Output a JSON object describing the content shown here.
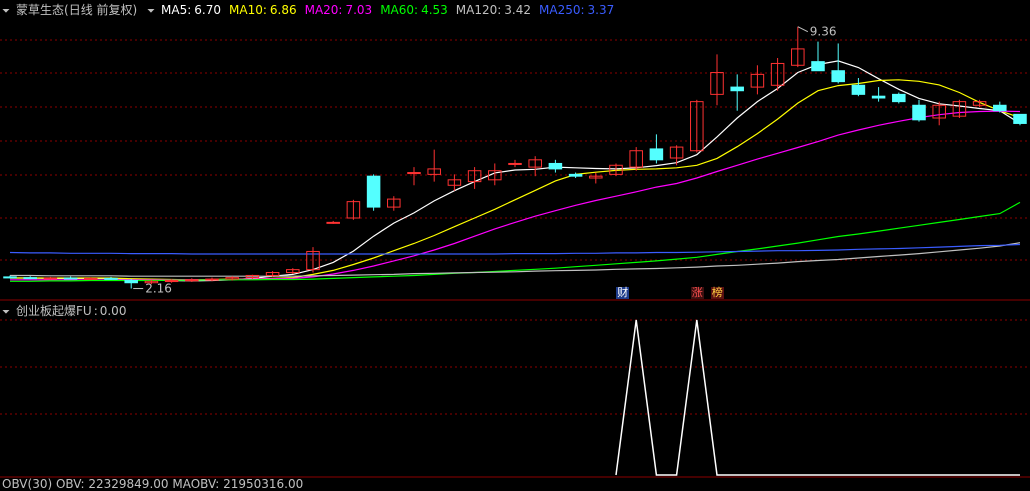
{
  "header": {
    "stock_name": "蒙草生态",
    "period": "(日线 前复权)",
    "ma": [
      {
        "label": "MA5:",
        "value": "6.70",
        "color": "#ffffff"
      },
      {
        "label": "MA10:",
        "value": "6.86",
        "color": "#ffff00"
      },
      {
        "label": "MA20:",
        "value": "7.03",
        "color": "#ff00ff"
      },
      {
        "label": "MA60:",
        "value": "4.53",
        "color": "#00ff00"
      },
      {
        "label": "MA120:",
        "value": "3.42",
        "color": "#c0c0c0"
      },
      {
        "label": "MA250:",
        "value": "3.37",
        "color": "#3a5cff"
      }
    ]
  },
  "indicator": {
    "name": "创业板起爆FU",
    "sep": ":",
    "value": "0.00"
  },
  "bottom": {
    "text": "OBV(30)  OBV: 22329849.00  MAOBV: 21950316.00"
  },
  "badges": [
    {
      "text": "财",
      "color": "#ffffff",
      "bg": "#1e3c8c"
    },
    {
      "text": "涨",
      "color": "#ff5050",
      "bg": "#3c1010"
    },
    {
      "text": "榜",
      "color": "#ffd040",
      "bg": "#5a1010"
    }
  ],
  "annotations": {
    "high": "9.36",
    "low": "2.16"
  },
  "colors": {
    "up": "#ff3232",
    "down": "#54ffff",
    "grid": "#8b0000",
    "signal": "#ffffff"
  },
  "chart_data": [
    {
      "type": "candlestick",
      "title": "蒙草生态 (日线 前复权)",
      "ylim": [
        1.9,
        9.6
      ],
      "candles": [
        {
          "o": 2.48,
          "h": 2.52,
          "l": 2.44,
          "c": 2.46
        },
        {
          "o": 2.46,
          "h": 2.5,
          "l": 2.42,
          "c": 2.44
        },
        {
          "o": 2.44,
          "h": 2.48,
          "l": 2.4,
          "c": 2.45
        },
        {
          "o": 2.45,
          "h": 2.49,
          "l": 2.41,
          "c": 2.43
        },
        {
          "o": 2.43,
          "h": 2.47,
          "l": 2.39,
          "c": 2.44
        },
        {
          "o": 2.44,
          "h": 2.48,
          "l": 2.4,
          "c": 2.42
        },
        {
          "o": 2.38,
          "h": 2.42,
          "l": 2.16,
          "c": 2.32
        },
        {
          "o": 2.32,
          "h": 2.4,
          "l": 2.28,
          "c": 2.36
        },
        {
          "o": 2.36,
          "h": 2.42,
          "l": 2.32,
          "c": 2.38
        },
        {
          "o": 2.38,
          "h": 2.44,
          "l": 2.34,
          "c": 2.4
        },
        {
          "o": 2.4,
          "h": 2.46,
          "l": 2.36,
          "c": 2.42
        },
        {
          "o": 2.42,
          "h": 2.5,
          "l": 2.38,
          "c": 2.46
        },
        {
          "o": 2.46,
          "h": 2.54,
          "l": 2.42,
          "c": 2.52
        },
        {
          "o": 2.52,
          "h": 2.64,
          "l": 2.48,
          "c": 2.6
        },
        {
          "o": 2.6,
          "h": 2.72,
          "l": 2.56,
          "c": 2.68
        },
        {
          "o": 2.68,
          "h": 3.3,
          "l": 2.6,
          "c": 3.18
        },
        {
          "o": 3.98,
          "h": 4.02,
          "l": 3.94,
          "c": 3.98
        },
        {
          "o": 4.1,
          "h": 4.6,
          "l": 4.05,
          "c": 4.55
        },
        {
          "o": 5.25,
          "h": 5.3,
          "l": 4.3,
          "c": 4.4
        },
        {
          "o": 4.4,
          "h": 4.7,
          "l": 4.3,
          "c": 4.62
        },
        {
          "o": 5.35,
          "h": 5.5,
          "l": 5.0,
          "c": 5.35
        },
        {
          "o": 5.3,
          "h": 5.98,
          "l": 5.1,
          "c": 5.45
        },
        {
          "o": 5.0,
          "h": 5.3,
          "l": 4.85,
          "c": 5.15
        },
        {
          "o": 5.1,
          "h": 5.5,
          "l": 4.9,
          "c": 5.4
        },
        {
          "o": 5.15,
          "h": 5.6,
          "l": 5.0,
          "c": 5.4
        },
        {
          "o": 5.6,
          "h": 5.7,
          "l": 5.5,
          "c": 5.6
        },
        {
          "o": 5.5,
          "h": 5.8,
          "l": 5.25,
          "c": 5.7
        },
        {
          "o": 5.6,
          "h": 5.7,
          "l": 5.35,
          "c": 5.45
        },
        {
          "o": 5.3,
          "h": 5.35,
          "l": 5.2,
          "c": 5.25
        },
        {
          "o": 5.2,
          "h": 5.35,
          "l": 5.05,
          "c": 5.25
        },
        {
          "o": 5.3,
          "h": 5.6,
          "l": 5.25,
          "c": 5.55
        },
        {
          "o": 5.5,
          "h": 6.05,
          "l": 5.4,
          "c": 5.95
        },
        {
          "o": 6.0,
          "h": 6.4,
          "l": 5.6,
          "c": 5.7
        },
        {
          "o": 5.75,
          "h": 6.1,
          "l": 5.55,
          "c": 6.05
        },
        {
          "o": 5.95,
          "h": 7.35,
          "l": 5.9,
          "c": 7.3
        },
        {
          "o": 7.5,
          "h": 8.6,
          "l": 7.2,
          "c": 8.1
        },
        {
          "o": 7.7,
          "h": 8.05,
          "l": 7.05,
          "c": 7.6
        },
        {
          "o": 7.7,
          "h": 8.3,
          "l": 7.5,
          "c": 8.05
        },
        {
          "o": 7.75,
          "h": 8.5,
          "l": 7.6,
          "c": 8.35
        },
        {
          "o": 8.3,
          "h": 9.36,
          "l": 8.25,
          "c": 8.75
        },
        {
          "o": 8.4,
          "h": 8.95,
          "l": 8.2,
          "c": 8.15
        },
        {
          "o": 8.15,
          "h": 8.9,
          "l": 7.8,
          "c": 7.85
        },
        {
          "o": 7.75,
          "h": 7.95,
          "l": 7.45,
          "c": 7.5
        },
        {
          "o": 7.45,
          "h": 7.7,
          "l": 7.3,
          "c": 7.4
        },
        {
          "o": 7.5,
          "h": 7.55,
          "l": 7.25,
          "c": 7.3
        },
        {
          "o": 7.2,
          "h": 7.35,
          "l": 6.75,
          "c": 6.8
        },
        {
          "o": 6.85,
          "h": 7.3,
          "l": 6.65,
          "c": 7.2
        },
        {
          "o": 6.9,
          "h": 7.35,
          "l": 6.85,
          "c": 7.3
        },
        {
          "o": 7.2,
          "h": 7.35,
          "l": 7.15,
          "c": 7.3
        },
        {
          "o": 7.2,
          "h": 7.3,
          "l": 7.0,
          "c": 7.05
        },
        {
          "o": 6.95,
          "h": 6.95,
          "l": 6.65,
          "c": 6.7
        }
      ],
      "ma_lines": [
        {
          "name": "MA5",
          "color": "#ffffff",
          "values": [
            2.45,
            2.45,
            2.44,
            2.44,
            2.44,
            2.44,
            2.41,
            2.39,
            2.38,
            2.37,
            2.38,
            2.4,
            2.44,
            2.5,
            2.55,
            2.68,
            2.88,
            3.19,
            3.6,
            3.96,
            4.24,
            4.57,
            4.85,
            5.1,
            5.34,
            5.42,
            5.44,
            5.5,
            5.48,
            5.46,
            5.45,
            5.48,
            5.54,
            5.62,
            5.84,
            6.33,
            6.85,
            7.3,
            7.66,
            8.1,
            8.32,
            8.42,
            8.24,
            7.93,
            7.64,
            7.39,
            7.24,
            7.18,
            7.11,
            7.05,
            6.7
          ]
        },
        {
          "name": "MA10",
          "color": "#ffff00",
          "values": [
            2.45,
            2.45,
            2.45,
            2.45,
            2.45,
            2.45,
            2.43,
            2.42,
            2.41,
            2.4,
            2.41,
            2.42,
            2.42,
            2.44,
            2.46,
            2.55,
            2.66,
            2.82,
            3.0,
            3.2,
            3.4,
            3.62,
            3.86,
            4.1,
            4.34,
            4.6,
            4.86,
            5.12,
            5.3,
            5.36,
            5.41,
            5.44,
            5.45,
            5.48,
            5.55,
            5.74,
            6.06,
            6.42,
            6.82,
            7.26,
            7.6,
            7.74,
            7.8,
            7.88,
            7.9,
            7.86,
            7.76,
            7.55,
            7.28,
            7.05,
            6.86
          ]
        },
        {
          "name": "MA20",
          "color": "#ff00ff",
          "values": [
            2.4,
            2.4,
            2.4,
            2.4,
            2.4,
            2.4,
            2.4,
            2.4,
            2.4,
            2.4,
            2.4,
            2.41,
            2.42,
            2.43,
            2.44,
            2.48,
            2.56,
            2.66,
            2.78,
            2.92,
            3.06,
            3.22,
            3.4,
            3.6,
            3.8,
            3.98,
            4.15,
            4.3,
            4.45,
            4.58,
            4.7,
            4.82,
            4.95,
            5.05,
            5.2,
            5.38,
            5.55,
            5.72,
            5.88,
            6.04,
            6.2,
            6.38,
            6.52,
            6.65,
            6.76,
            6.86,
            6.94,
            7.0,
            7.03,
            7.04,
            7.03
          ]
        },
        {
          "name": "MA60",
          "color": "#00ff00",
          "values": [
            2.36,
            2.36,
            2.37,
            2.37,
            2.38,
            2.38,
            2.38,
            2.38,
            2.39,
            2.39,
            2.4,
            2.4,
            2.4,
            2.41,
            2.41,
            2.42,
            2.44,
            2.46,
            2.48,
            2.5,
            2.52,
            2.55,
            2.58,
            2.6,
            2.63,
            2.66,
            2.69,
            2.72,
            2.76,
            2.8,
            2.84,
            2.88,
            2.92,
            2.97,
            3.02,
            3.1,
            3.18,
            3.25,
            3.33,
            3.41,
            3.5,
            3.59,
            3.66,
            3.74,
            3.82,
            3.9,
            3.98,
            4.06,
            4.14,
            4.22,
            4.53
          ]
        },
        {
          "name": "MA120",
          "color": "#c0c0c0",
          "values": [
            2.52,
            2.52,
            2.51,
            2.51,
            2.51,
            2.51,
            2.5,
            2.5,
            2.5,
            2.5,
            2.5,
            2.5,
            2.5,
            2.5,
            2.5,
            2.51,
            2.52,
            2.53,
            2.54,
            2.55,
            2.57,
            2.58,
            2.59,
            2.6,
            2.61,
            2.62,
            2.64,
            2.65,
            2.66,
            2.67,
            2.69,
            2.7,
            2.71,
            2.73,
            2.75,
            2.78,
            2.8,
            2.83,
            2.86,
            2.9,
            2.93,
            2.96,
            3.0,
            3.04,
            3.08,
            3.12,
            3.17,
            3.22,
            3.27,
            3.33,
            3.42
          ]
        },
        {
          "name": "MA250",
          "color": "#3a5cff",
          "values": [
            3.15,
            3.14,
            3.14,
            3.13,
            3.13,
            3.13,
            3.12,
            3.12,
            3.12,
            3.11,
            3.11,
            3.11,
            3.11,
            3.11,
            3.11,
            3.11,
            3.11,
            3.11,
            3.11,
            3.11,
            3.11,
            3.11,
            3.11,
            3.11,
            3.11,
            3.12,
            3.12,
            3.12,
            3.13,
            3.13,
            3.14,
            3.14,
            3.15,
            3.15,
            3.16,
            3.17,
            3.18,
            3.19,
            3.2,
            3.2,
            3.21,
            3.22,
            3.24,
            3.25,
            3.26,
            3.28,
            3.3,
            3.32,
            3.34,
            3.35,
            3.37
          ]
        }
      ]
    },
    {
      "type": "line",
      "title": "创业板起爆FU",
      "ylim": [
        0,
        1
      ],
      "values": [
        0,
        0,
        0,
        0,
        0,
        0,
        0,
        0,
        0,
        0,
        0,
        0,
        0,
        0,
        0,
        0,
        0,
        0,
        0,
        0,
        0,
        0,
        0,
        0,
        0,
        0,
        0,
        0,
        0,
        0,
        0,
        1,
        0,
        0,
        1,
        0,
        0,
        0,
        0,
        0,
        0,
        0,
        0,
        0,
        0,
        0,
        0,
        0,
        0,
        0,
        0
      ]
    }
  ]
}
